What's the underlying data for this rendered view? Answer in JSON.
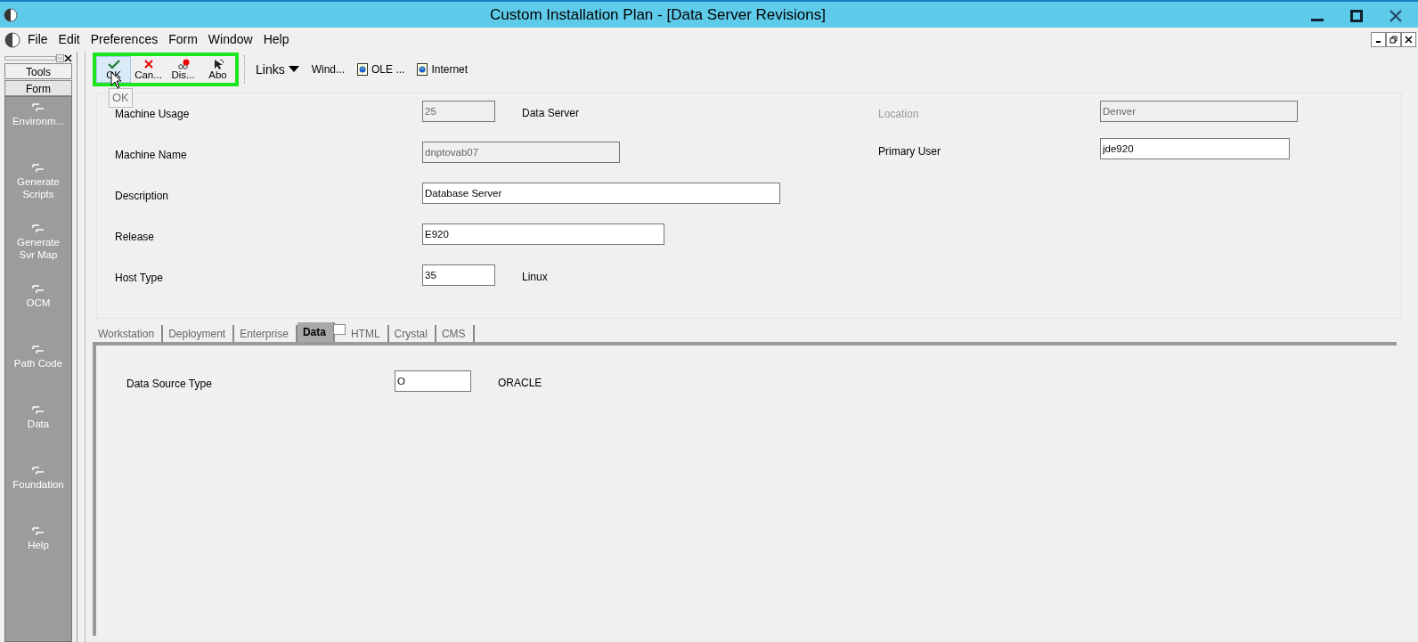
{
  "window": {
    "title": "Custom Installation Plan - [Data Server Revisions]"
  },
  "menu": [
    "File",
    "Edit",
    "Preferences",
    "Form",
    "Window",
    "Help"
  ],
  "sidebar": {
    "buttons": [
      {
        "label": "Tools",
        "selected": false
      },
      {
        "label": "Form",
        "selected": true
      }
    ],
    "items": [
      {
        "label": "Environm..."
      },
      {
        "label": "Generate Scripts"
      },
      {
        "label": "Generate Svr Map"
      },
      {
        "label": "OCM"
      },
      {
        "label": "Path Code"
      },
      {
        "label": "Data"
      },
      {
        "label": "Foundation"
      },
      {
        "label": "Help"
      }
    ]
  },
  "toolbar": {
    "actions": [
      {
        "label": "OK",
        "kind": "ok",
        "hovered": true
      },
      {
        "label": "Can...",
        "kind": "cancel",
        "hovered": false
      },
      {
        "label": "Dis...",
        "kind": "display",
        "hovered": false
      },
      {
        "label": "Abo",
        "kind": "about",
        "hovered": false
      }
    ],
    "links_label": "Links",
    "links": [
      {
        "label": "Wind...",
        "kind": "plain"
      },
      {
        "label": "OLE ...",
        "kind": "doc"
      },
      {
        "label": "Internet",
        "kind": "doc"
      }
    ],
    "tooltip": "OK"
  },
  "form": {
    "left": [
      {
        "label": "Machine Usage",
        "value": "25",
        "disabled": true,
        "note": "Data Server"
      },
      {
        "label": "Machine Name",
        "value": "dnptovab07",
        "disabled": true
      },
      {
        "label": "Description",
        "value": "Database Server",
        "disabled": false
      },
      {
        "label": "Release",
        "value": "E920",
        "disabled": false
      },
      {
        "label": "Host Type",
        "value": "35",
        "disabled": false,
        "note": "Linux"
      }
    ],
    "right": [
      {
        "label": "Location",
        "value": "Denver",
        "disabled": true
      },
      {
        "label": "Primary User",
        "value": "jde920",
        "disabled": false
      }
    ]
  },
  "tabs": [
    {
      "label": "Workstation",
      "selected": false
    },
    {
      "label": "Deployment",
      "selected": false
    },
    {
      "label": "Enterprise",
      "selected": false
    },
    {
      "label": "Data",
      "selected": true
    },
    {
      "label": "HTML",
      "selected": false
    },
    {
      "label": "Crystal",
      "selected": false
    },
    {
      "label": "CMS",
      "selected": false
    }
  ],
  "tab_content": [
    {
      "label": "Data Source Type",
      "value": "O",
      "disabled": false,
      "note": "ORACLE"
    }
  ]
}
